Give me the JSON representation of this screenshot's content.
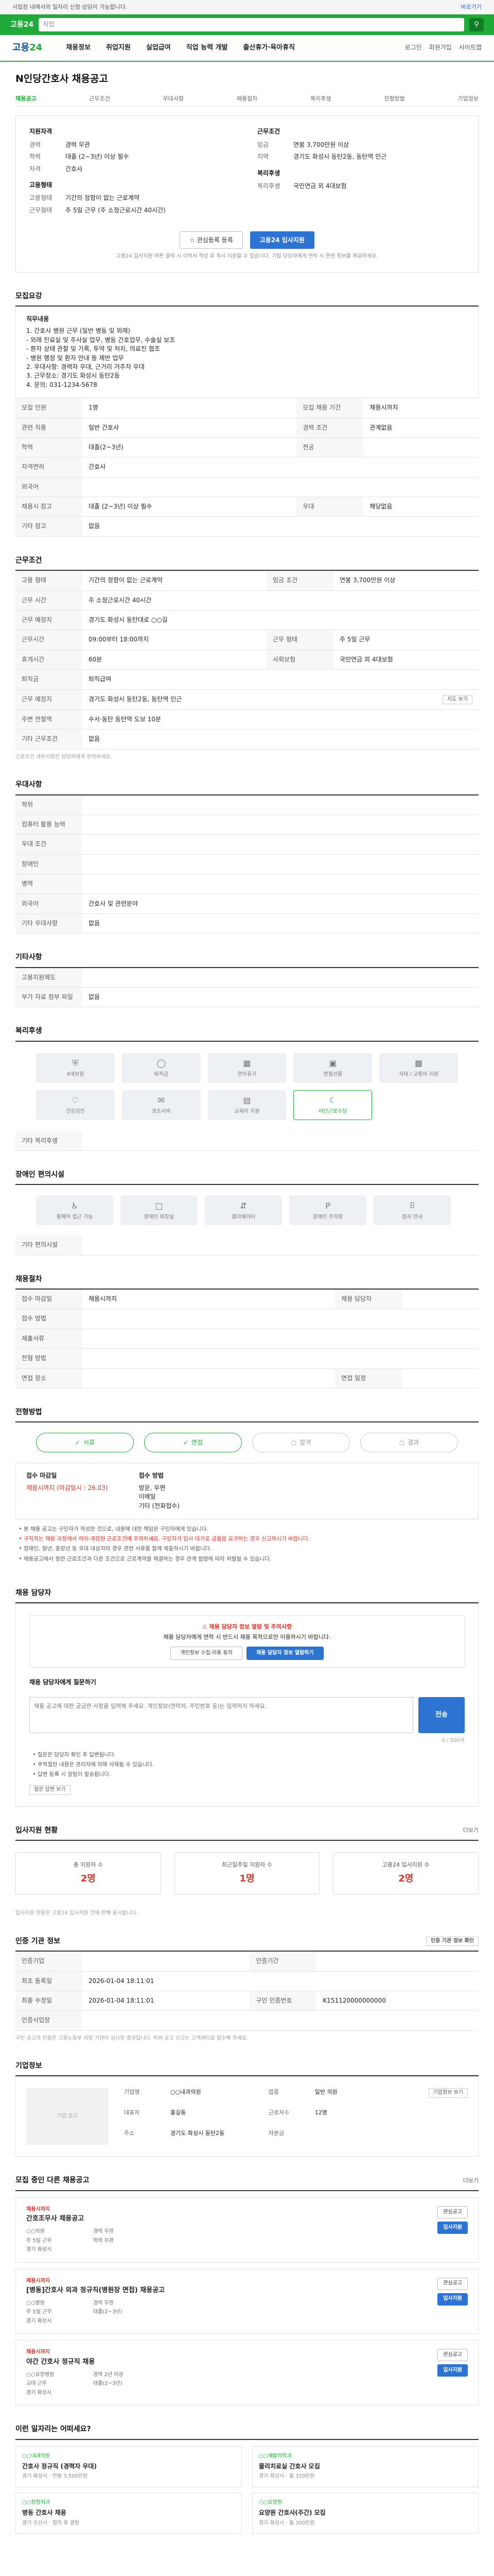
{
  "topbar": {
    "left": "사업장 내에서의 일자리 신청·상담이 가능합니다.",
    "link": "바로가기"
  },
  "search": {
    "logo": "고용24",
    "placeholder": "직업"
  },
  "nav": {
    "brand_a": "고용",
    "brand_b": "24",
    "items": [
      "채용정보",
      "취업지원",
      "실업급여",
      "직업 능력 개발",
      "출산휴가·육아휴직"
    ],
    "right": [
      "로그인",
      "회원가입",
      "사이트맵"
    ]
  },
  "page": {
    "title": "N인당간호사 채용공고",
    "subnav": [
      "채용공고",
      "근무조건",
      "우대사항",
      "채용절차",
      "복리후생",
      "전형방법",
      "기업정보"
    ]
  },
  "summary": {
    "label_left": "지원자격",
    "label_right": "근무조건",
    "left": [
      {
        "k": "경력",
        "v": "경력 무관"
      },
      {
        "k": "학력",
        "v": "대졸 (2~3년) 이상 필수"
      },
      {
        "k": "자격",
        "v": "간호사"
      }
    ],
    "right": [
      {
        "k": "임금",
        "v": "연봉 3,700만원 이상"
      },
      {
        "k": "지역",
        "v": "경기도 화성시 동탄2동, 동탄역 인근"
      }
    ],
    "label_left2": "고용형태",
    "label_right2": "복리후생",
    "left2": [
      {
        "k": "고용형태",
        "v": "기간의 정함이 없는 근로계약"
      },
      {
        "k": "근무형태",
        "v": "주 5일 근무 (주 소정근로시간 40시간)"
      }
    ],
    "right2": [
      {
        "k": "복리후생",
        "v": "국민연금 외 4대보험"
      }
    ],
    "btn_save": "관심등록 등록",
    "btn_apply": "고용24 입사지원",
    "note": "고용24 입사지원 버튼 클릭 시 이력서 작성 후 즉시 지원할 수 있습니다. 기업 담당자에게 연락 시 관련 정보를 제공하세요."
  },
  "desc": {
    "title": "모집요강",
    "head": "직무내용",
    "lines": [
      "1. 간호사 병원 근무 (일반 병동 및 외래)",
      "- 외래 진료실 및 주사실 업무, 병동 간호업무, 수술실 보조",
      "- 환자 상태 관찰 및 기록, 투약 및 처치, 의료진 협조",
      "- 병원 행정 및 환자 안내 등 제반 업무",
      "2. 우대사항: 경력자 우대, 근거리 거주자 우대",
      "3. 근무장소: 경기도 화성시 동탄2동",
      "4. 문의: 031-1234-5678"
    ]
  },
  "recruit": [
    {
      "k": "모집 인원",
      "v": "1명",
      "k2": "모집 채용 기간",
      "v2": "채용시까지"
    },
    {
      "k": "관련 직종",
      "v": "일반 간호사",
      "k2": "경력 조건",
      "v2": "관계없음"
    },
    {
      "k": "학력",
      "v": "대졸(2~3년)",
      "k2": "전공",
      "v2": ""
    },
    {
      "k": "자격면허",
      "v": "간호사",
      "k2": "",
      "v2": ""
    },
    {
      "k": "외국어",
      "v": "",
      "k2": "",
      "v2": ""
    },
    {
      "k": "채용시 참고",
      "v": "대졸 (2~3년) 이상 필수",
      "k2": "우대",
      "v2": "해당없음"
    },
    {
      "k": "기타 참고",
      "v": "없음",
      "k2": "",
      "v2": ""
    }
  ],
  "work": {
    "title": "근무조건",
    "rows": [
      {
        "k": "고용 형태",
        "v": "기간의 정함이 없는 근로계약",
        "k2": "임금 조건",
        "v2": "연봉 3,700만원 이상"
      },
      {
        "k": "근무 시간",
        "v": "주 소정근로시간 40시간",
        "k2": "",
        "v2": ""
      },
      {
        "k": "근무 예정지",
        "v": "경기도 화성시 동탄대로 ○○길",
        "k2": "",
        "v2": ""
      },
      {
        "k": "근무시간",
        "v": "09:00부터 18:00까지",
        "k2": "근무 형태",
        "v2": "주 5일 근무"
      },
      {
        "k": "휴게시간",
        "v": "60분",
        "k2": "사회보험",
        "v2": "국민연금 외 4대보험"
      },
      {
        "k": "퇴직금",
        "v": "퇴직급여",
        "k2": "",
        "v2": ""
      },
      {
        "k": "근무 예정지",
        "v": "경기도 화성시 동탄2동, 동탄역 인근",
        "k2": "",
        "v2": ""
      },
      {
        "k": "주변 전철역",
        "v": "수서·동탄 동탄역 도보 10분",
        "k2": "",
        "v2": ""
      },
      {
        "k": "기타 근무조건",
        "v": "없음",
        "k2": "",
        "v2": ""
      }
    ],
    "map_btn": "지도 보기",
    "note": "근로조건 세부사항은 담당자에게 문의하세요."
  },
  "pref": {
    "title": "우대사항",
    "rows": [
      {
        "k": "학위",
        "v": ""
      },
      {
        "k": "컴퓨터 활용 능력",
        "v": ""
      },
      {
        "k": "우대 조건",
        "v": ""
      },
      {
        "k": "장애인",
        "v": ""
      },
      {
        "k": "병역",
        "v": ""
      },
      {
        "k": "외국어",
        "v": "간호사 및 관련분야"
      },
      {
        "k": "기타 우대사항",
        "v": "없음"
      }
    ]
  },
  "other": {
    "title": "기타사항",
    "rows": [
      {
        "k": "고용지원제도",
        "v": ""
      },
      {
        "k": "부가 자료 첨부 파일",
        "v": "없음"
      }
    ]
  },
  "welfare": {
    "title": "복리후생",
    "items": [
      "4대보험",
      "퇴직금",
      "연차휴가",
      "명절선물",
      "식대 / 교통비 지원",
      "건강검진",
      "경조사비",
      "교육비 지원",
      "야간근로수당"
    ],
    "active": 8,
    "etc_label": "기타 복리후생"
  },
  "disab": {
    "title": "장애인 편의시설",
    "items": [
      "휠체어 접근 가능",
      "장애인 화장실",
      "엘리베이터",
      "장애인 주차장",
      "점자 안내"
    ],
    "etc_label": "기타 편의시설"
  },
  "manager": {
    "title": "채용절차",
    "rows": [
      {
        "k": "접수 마감일",
        "v": "채용시까지",
        "k2": "채용 담당자",
        "v2": ""
      },
      {
        "k": "접수 방법",
        "v": "",
        "k2": "",
        "v2": ""
      },
      {
        "k": "제출서류",
        "v": "",
        "k2": "",
        "v2": ""
      },
      {
        "k": "전형 방법",
        "v": "",
        "k2": "",
        "v2": ""
      },
      {
        "k": "면접 장소",
        "v": "",
        "k2": "면접 일정",
        "v2": ""
      }
    ]
  },
  "process": {
    "title": "전형방법",
    "steps": [
      "서류",
      "면접",
      "합격",
      "결과"
    ],
    "apply_title": "접수 마감일",
    "apply_val": "채용시까지 (마감일시 : 26.03)",
    "doc_title": "접수 방법",
    "doc_lines": [
      "방문, 우편",
      "이메일",
      "기타 (전화접수)"
    ],
    "notes": [
      {
        "t": "본 채용 공고는 구인자가 작성한 것으로, 내용에 대한 책임은 구인자에게 있습니다.",
        "red": false
      },
      {
        "t": "구직자는 채용 과정에서 허위·과장된 근로조건에 주의하세요. 구인자가 입사 대가로 금품을 요구하는 경우 신고하시기 바랍니다.",
        "red": true
      },
      {
        "t": "장애인, 청년, 중장년 등 우대 대상자의 경우 관련 서류를 함께 제출하시기 바랍니다.",
        "red": false
      },
      {
        "t": "채용공고에서 정한 근로조건과 다른 조건으로 근로계약을 체결하는 경우 관계 법령에 따라 처벌될 수 있습니다.",
        "red": false
      }
    ]
  },
  "contact": {
    "title": "채용 담당자",
    "notice_t": "채용 담당자 정보 열람 및 주의사항",
    "notice_b": "채용 담당자에게 연락 시 반드시 채용 목적으로만 이용하시기 바랍니다.",
    "btn1": "개인정보 수집·이용 동의",
    "btn2": "채용 담당자 정보 열람하기",
    "q_title": "채용 담당자에게 질문하기",
    "q_placeholder": "채용 공고에 대한 궁금한 사항을 입력해 주세요. 개인정보(연락처, 주민번호 등)는 입력하지 마세요.",
    "q_btn": "전송",
    "q_count": "0 / 500자",
    "q_notes": [
      "질문은 담당자 확인 후 답변됩니다.",
      "부적절한 내용은 관리자에 의해 삭제될 수 있습니다.",
      "답변 등록 시 알림이 발송됩니다."
    ],
    "q_link": "질문 답변 보기"
  },
  "status": {
    "title": "입사지원 현황",
    "more": "더보기",
    "items": [
      {
        "a": "총 지원자 수",
        "b": "2명"
      },
      {
        "a": "최근일주일 지원자 수",
        "b": "1명"
      },
      {
        "a": "고용24 입사지원 수",
        "b": "2명"
      }
    ],
    "note": "입사지원 현황은 고용24 입사지원 건에 한해 표시됩니다."
  },
  "info": {
    "title": "인증 기관 정보",
    "btn": "인증 기관 정보 확인",
    "rows": [
      {
        "k": "인증기업",
        "v": "",
        "k2": "인증기간",
        "v2": ""
      },
      {
        "k": "최초 등록일",
        "v": "2026-01-04 18:11:01",
        "k2": "",
        "v2": ""
      },
      {
        "k": "최종 수정일",
        "v": "2026-01-04 18:11:01",
        "k2": "구인 인증번호",
        "v2": "K151120000000000"
      },
      {
        "k": "인증사업장",
        "v": "",
        "k2": "",
        "v2": ""
      }
    ],
    "notes": "구인 공고의 인증은 고용노동부 지정 기관이 심사한 결과입니다. 허위 공고 신고는 고객센터로 접수해 주세요."
  },
  "company": {
    "title": "기업정보",
    "btn": "기업정보 보기",
    "rows": [
      {
        "k": "기업명",
        "v": "○○내과의원",
        "k2": "업종",
        "v2": "일반 의원"
      },
      {
        "k": "대표자",
        "v": "홍길동",
        "k2": "근로자수",
        "v2": "12명"
      },
      {
        "k": "주소",
        "v": "경기도 화성시 동탄2동",
        "k2": "자본금",
        "v2": ""
      }
    ],
    "img": "기업 로고"
  },
  "similar": {
    "title": "모집 중인 다른 채용공고",
    "more": "더보기",
    "items": [
      {
        "tag": "채용시까지",
        "co": "○○의원",
        "title": "간호조무사 채용공고",
        "m": [
          "경력 무관",
          "주 5일 근무",
          "학력 무관",
          "경기 화성시"
        ],
        "b1": "관심공고",
        "b2": "입사지원"
      },
      {
        "tag": "채용시까지",
        "co": "○○병원",
        "title": "[병동]간호사 외과 정규직(병원장 면접) 채용공고",
        "m": [
          "경력 무관",
          "주 5일 근무",
          "대졸(2~3년)",
          "경기 화성시"
        ],
        "b1": "관심공고",
        "b2": "입사지원"
      },
      {
        "tag": "채용시까지",
        "co": "○○요양병원",
        "title": "야간 간호사 정규직 채용",
        "m": [
          "경력 2년 이상",
          "교대 근무",
          "대졸(2~3년)",
          "경기 화성시"
        ],
        "b1": "관심공고",
        "b2": "입사지원"
      }
    ]
  },
  "recommend": {
    "title": "이런 일자리는 어떠세요?",
    "items": [
      {
        "co": "○○내과의원",
        "ti": "간호사 정규직 (경력자 우대)",
        "mt": "경기 화성시 · 연봉 3,500만원"
      },
      {
        "co": "○○재활의학과",
        "ti": "물리치료실 간호사 모집",
        "mt": "경기 화성시 · 월 320만원"
      },
      {
        "co": "○○정형외과",
        "ti": "병동 간호사 채용",
        "mt": "경기 오산시 · 협의 후 결정"
      },
      {
        "co": "○○요양원",
        "ti": "요양원 간호사(주간) 모집",
        "mt": "경기 화성시 · 월 300만원"
      }
    ]
  }
}
